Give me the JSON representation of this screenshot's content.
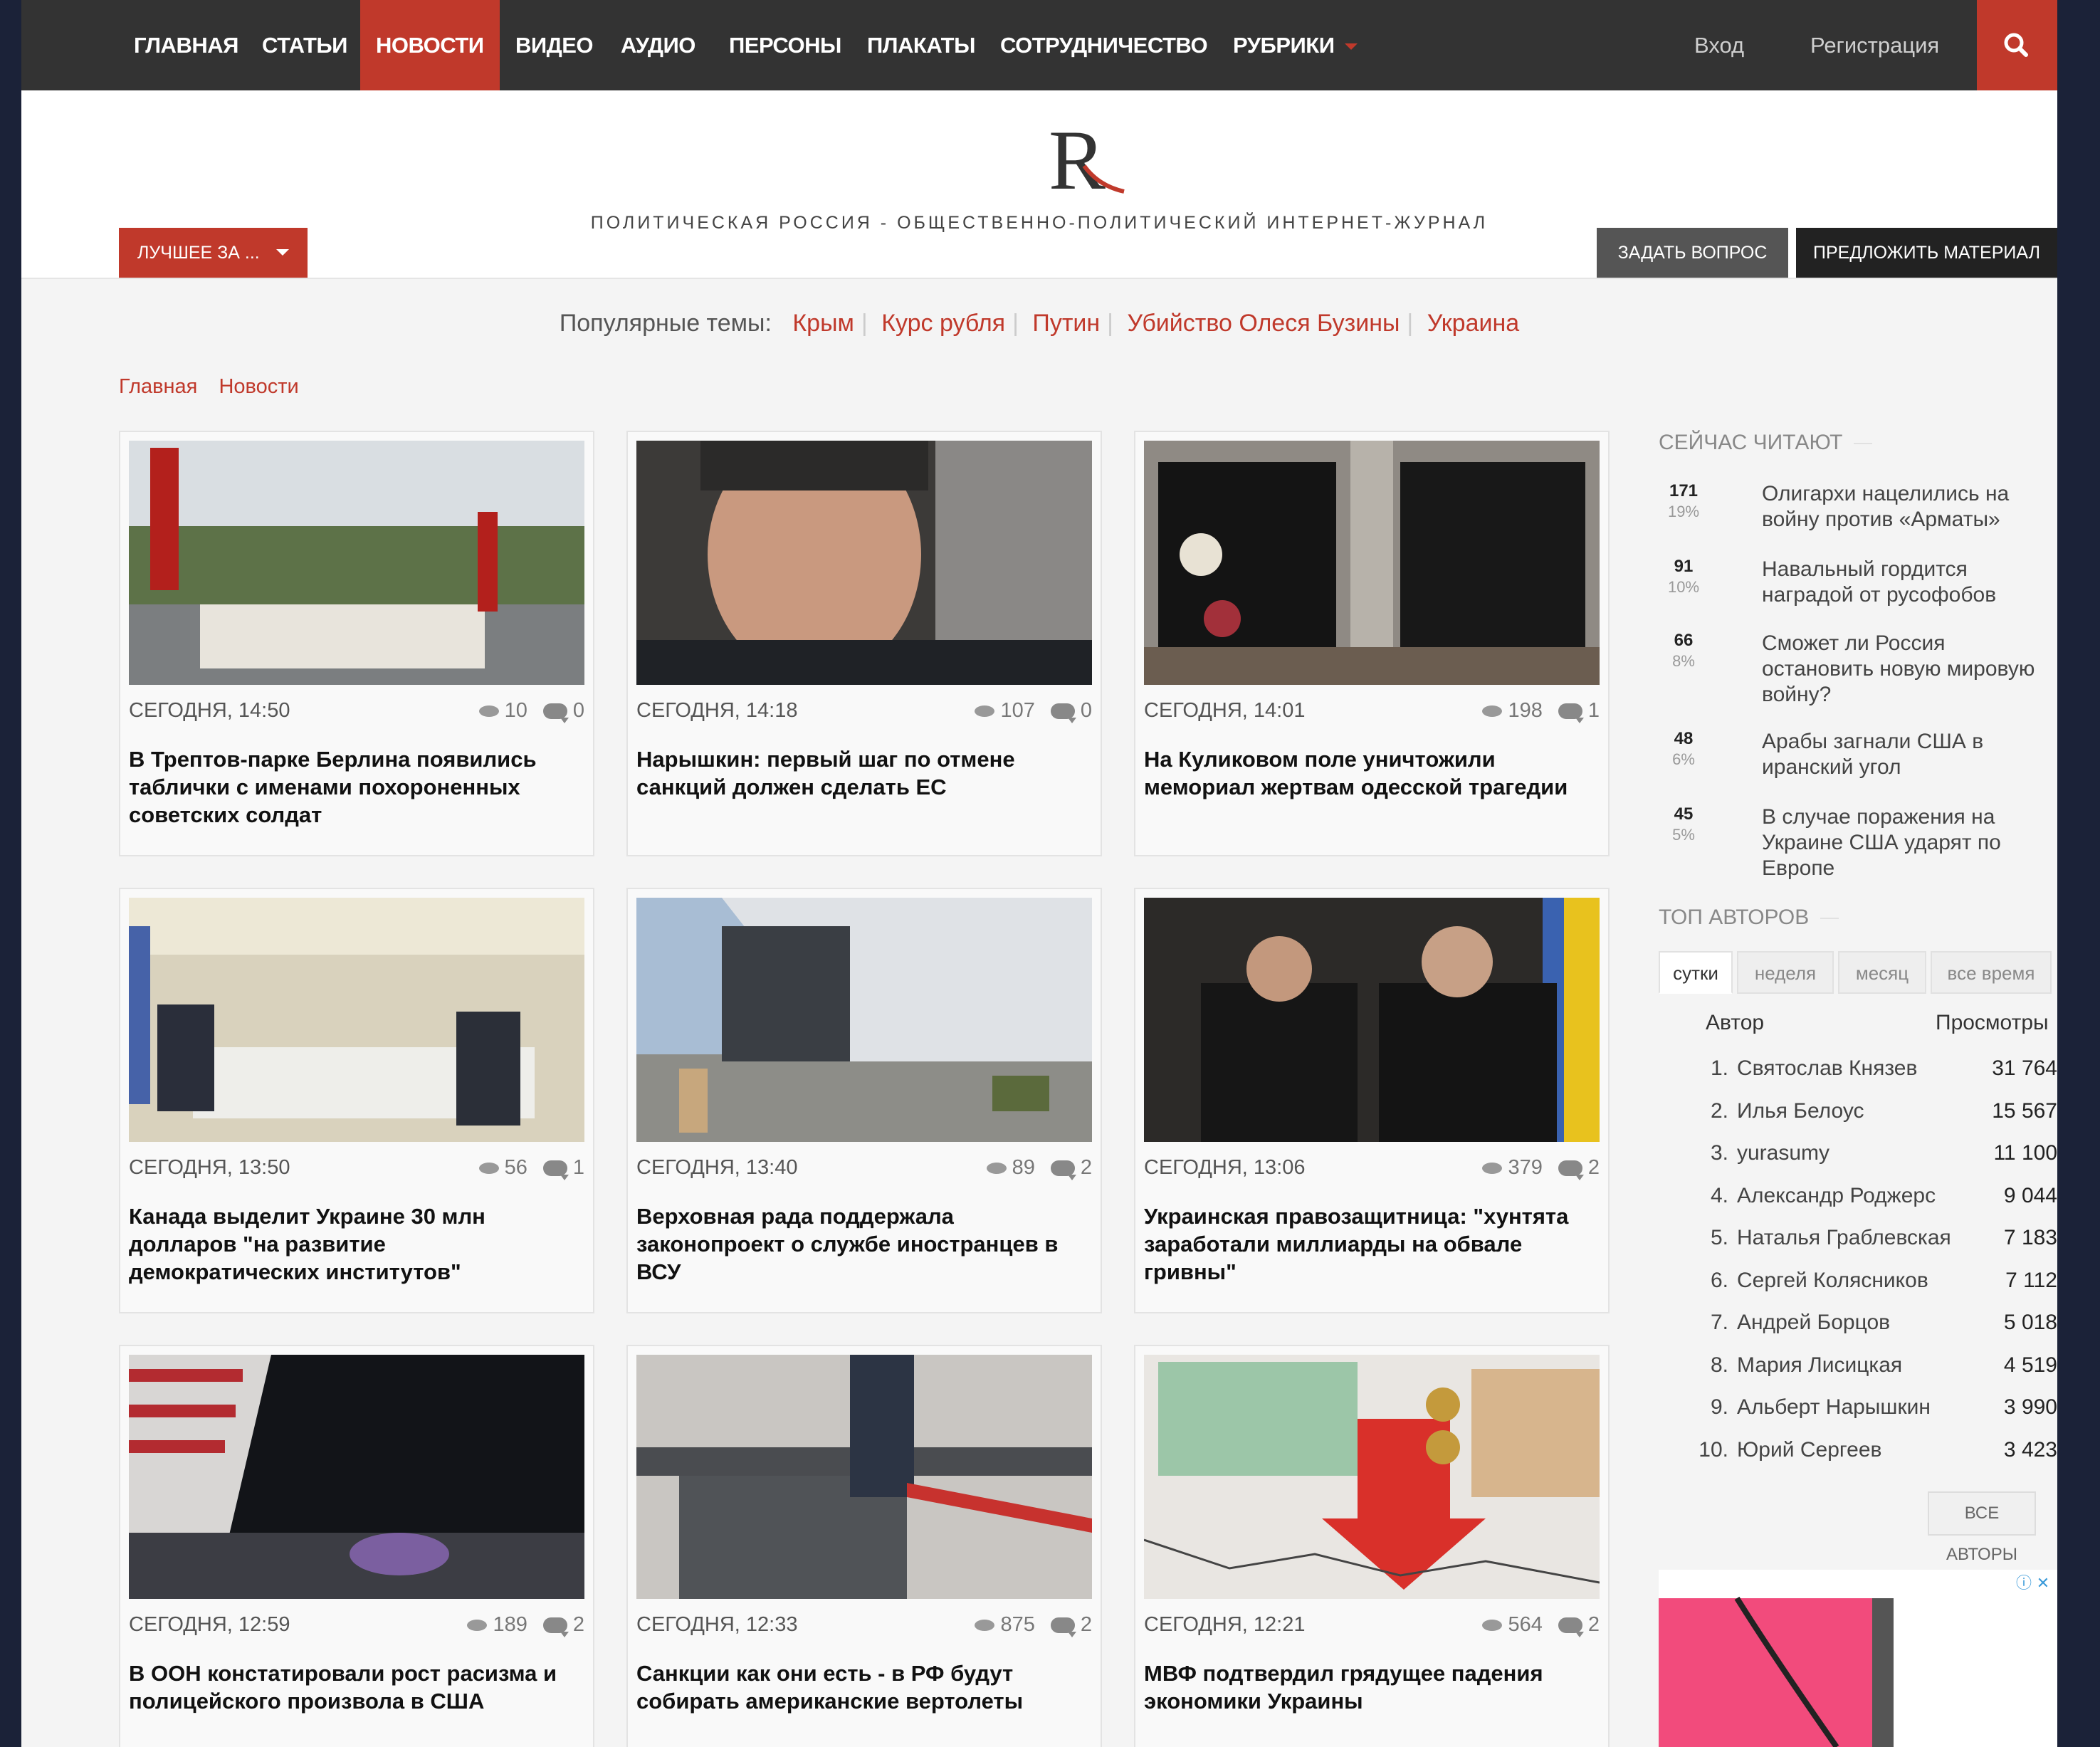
{
  "nav": {
    "items": [
      "ГЛАВНАЯ",
      "СТАТЬИ",
      "НОВОСТИ",
      "ВИДЕО",
      "АУДИО",
      "ПЕРСОНЫ",
      "ПЛАКАТЫ",
      "СОТРУДНИЧЕСТВО",
      "РУБРИКИ"
    ],
    "active": "НОВОСТИ",
    "login": "Вход",
    "register": "Регистрация",
    "search_icon": "search-icon"
  },
  "header": {
    "logo_icon": "r-logo",
    "tagline": "ПОЛИТИЧЕСКАЯ РОССИЯ - ОБЩЕСТВЕННО-ПОЛИТИЧЕСКИЙ ИНТЕРНЕТ-ЖУРНАЛ",
    "best_label": "ЛУЧШЕЕ ЗА ...",
    "ask_label": "ЗАДАТЬ ВОПРОС",
    "suggest_label": "ПРЕДЛОЖИТЬ МАТЕРИАЛ"
  },
  "popular": {
    "label": "Популярные темы:",
    "topics": [
      "Крым",
      "Курс рубля",
      "Путин",
      "Убийство Олеся Бузины",
      "Украина"
    ]
  },
  "breadcrumbs": [
    "Главная",
    "Новости"
  ],
  "cards": [
    {
      "date": "СЕГОДНЯ, 14:50",
      "views": "10",
      "comments": "0",
      "title": "В Трептов-парке Берлина появились таблички с именами похороненных советских солдат"
    },
    {
      "date": "СЕГОДНЯ, 14:18",
      "views": "107",
      "comments": "0",
      "title": "Нарышкин: первый шаг по отмене санкций должен сделать ЕС"
    },
    {
      "date": "СЕГОДНЯ, 14:01",
      "views": "198",
      "comments": "1",
      "title": "На Куликовом поле уничтожили мемориал жертвам одесской трагедии"
    },
    {
      "date": "СЕГОДНЯ, 13:50",
      "views": "56",
      "comments": "1",
      "title": "Канада выделит Украине 30 млн долларов \"на развитие демократических институтов\""
    },
    {
      "date": "СЕГОДНЯ, 13:40",
      "views": "89",
      "comments": "2",
      "title": "Верховная рада поддержала законопроект о службе иностранцев в ВСУ"
    },
    {
      "date": "СЕГОДНЯ, 13:06",
      "views": "379",
      "comments": "2",
      "title": "Украинская правозащитница: \"хунтята заработали миллиарды на обвале гривны\""
    },
    {
      "date": "СЕГОДНЯ, 12:59",
      "views": "189",
      "comments": "2",
      "title": "В ООН констатировали рост расизма и полицейского произвола в США"
    },
    {
      "date": "СЕГОДНЯ, 12:33",
      "views": "875",
      "comments": "2",
      "title": "Санкции как они есть - в РФ будут собирать американские вертолеты"
    },
    {
      "date": "СЕГОДНЯ, 12:21",
      "views": "564",
      "comments": "2",
      "title": "МВФ подтвердил грядущее падения экономики Украины"
    }
  ],
  "sidebar": {
    "reading_title": "СЕЙЧАС ЧИТАЮТ",
    "reading": [
      {
        "count": "171",
        "pct": "19%",
        "text": "Олигархи нацелились на войну против «Арматы»"
      },
      {
        "count": "91",
        "pct": "10%",
        "text": "Навальный гордится наградой от русофобов"
      },
      {
        "count": "66",
        "pct": "8%",
        "text": "Сможет ли Россия остановить новую мировую войну?"
      },
      {
        "count": "48",
        "pct": "6%",
        "text": "Арабы загнали США в иранский угол"
      },
      {
        "count": "45",
        "pct": "5%",
        "text": "В случае поражения на Украине США ударят по Европе"
      }
    ],
    "top_title": "ТОП АВТОРОВ",
    "tabs": [
      "сутки",
      "неделя",
      "месяц",
      "все время"
    ],
    "col_author": "Автор",
    "col_views": "Просмотры",
    "authors": [
      {
        "rank": "1.",
        "name": "Святослав Князев",
        "views": "31 764"
      },
      {
        "rank": "2.",
        "name": "Илья Белоус",
        "views": "15 567"
      },
      {
        "rank": "3.",
        "name": "yurasumy",
        "views": "11 100"
      },
      {
        "rank": "4.",
        "name": "Александр Роджерс",
        "views": "9 044"
      },
      {
        "rank": "5.",
        "name": "Наталья Граблевская",
        "views": "7 183"
      },
      {
        "rank": "6.",
        "name": "Сергей Колясников",
        "views": "7 112"
      },
      {
        "rank": "7.",
        "name": "Андрей Борцов",
        "views": "5 018"
      },
      {
        "rank": "8.",
        "name": "Мария Лисицкая",
        "views": "4 519"
      },
      {
        "rank": "9.",
        "name": "Альберт Нарышкин",
        "views": "3 990"
      },
      {
        "rank": "10.",
        "name": "Юрий Сергеев",
        "views": "3 423"
      }
    ],
    "all_authors": "ВСЕ АВТОРЫ",
    "ad_info_icon": "info-icon",
    "ad_close_icon": "close-icon"
  },
  "colors": {
    "accent": "#c0392b",
    "nav_bg": "#333333",
    "page_bg": "#f4f4f4"
  }
}
